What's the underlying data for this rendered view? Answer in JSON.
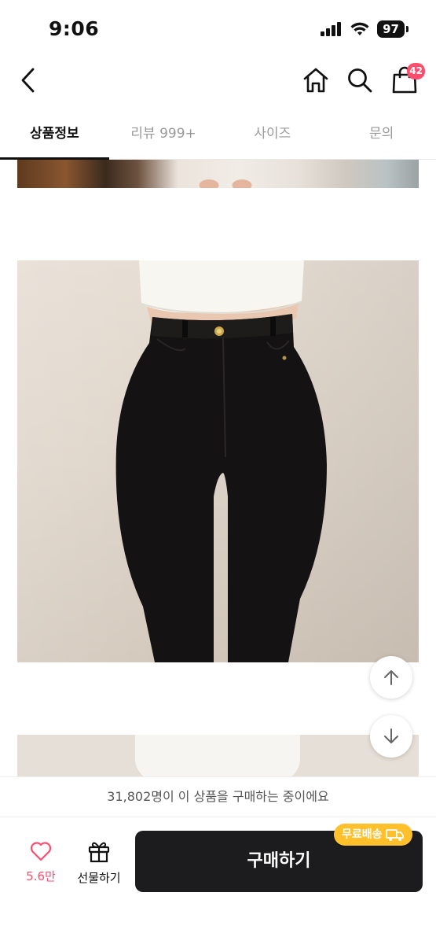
{
  "status_bar": {
    "time": "9:06",
    "battery": "97"
  },
  "header": {
    "cart_badge": "42"
  },
  "tabs": [
    {
      "label": "상품정보",
      "active": true
    },
    {
      "label": "리뷰 999+",
      "active": false
    },
    {
      "label": "사이즈",
      "active": false
    },
    {
      "label": "문의",
      "active": false
    }
  ],
  "notice": {
    "text": "31,802명이 이 상품을 구매하는 중이에요"
  },
  "bottom_bar": {
    "like_count": "5.6만",
    "gift_label": "선물하기",
    "buy_label": "구매하기",
    "free_shipping_badge": "무료배송"
  },
  "colors": {
    "accent": "#ff4d6d",
    "buy_button": "#1c1c1e",
    "free_shipping": "#ffc02b"
  },
  "icons": [
    "back-arrow-icon",
    "home-icon",
    "search-icon",
    "shopping-bag-icon",
    "scroll-up-icon",
    "scroll-down-icon",
    "heart-icon",
    "gift-icon",
    "truck-icon"
  ]
}
